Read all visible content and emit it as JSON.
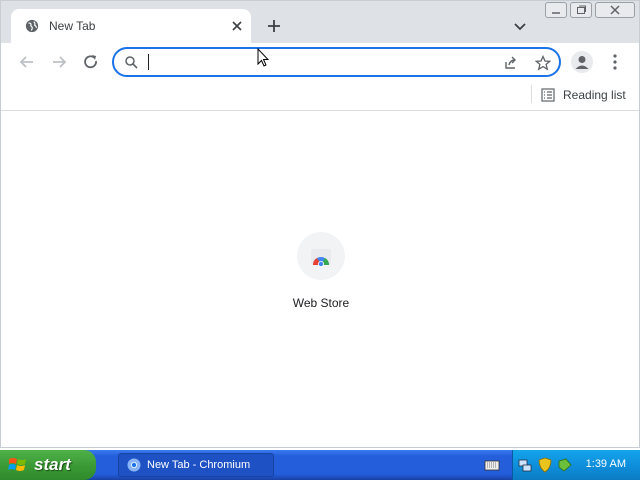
{
  "browser": {
    "tab_title": "New Tab",
    "omnibox_value": "",
    "reading_list_label": "Reading list",
    "shortcuts": [
      {
        "label": "Web Store"
      }
    ]
  },
  "taskbar": {
    "start_label": "start",
    "task_button_label": "New Tab - Chromium",
    "clock": "1:39 AM"
  },
  "icons": {
    "tab": "globe-icon",
    "close": "close-icon",
    "new_tab": "plus-icon",
    "tab_search": "chevron-down-icon",
    "back": "back-arrow-icon",
    "forward": "forward-arrow-icon",
    "reload": "reload-icon",
    "search": "search-icon",
    "share": "share-icon",
    "bookmark": "star-icon",
    "profile": "avatar-icon",
    "menu": "kebab-menu-icon",
    "reading_list": "reading-list-icon",
    "web_store": "web-store-icon"
  },
  "colors": {
    "tabstrip_bg": "#dee1e6",
    "omnibox_focus": "#1a73e8",
    "taskbar_blue": "#245edb",
    "start_green": "#3c9b36"
  }
}
